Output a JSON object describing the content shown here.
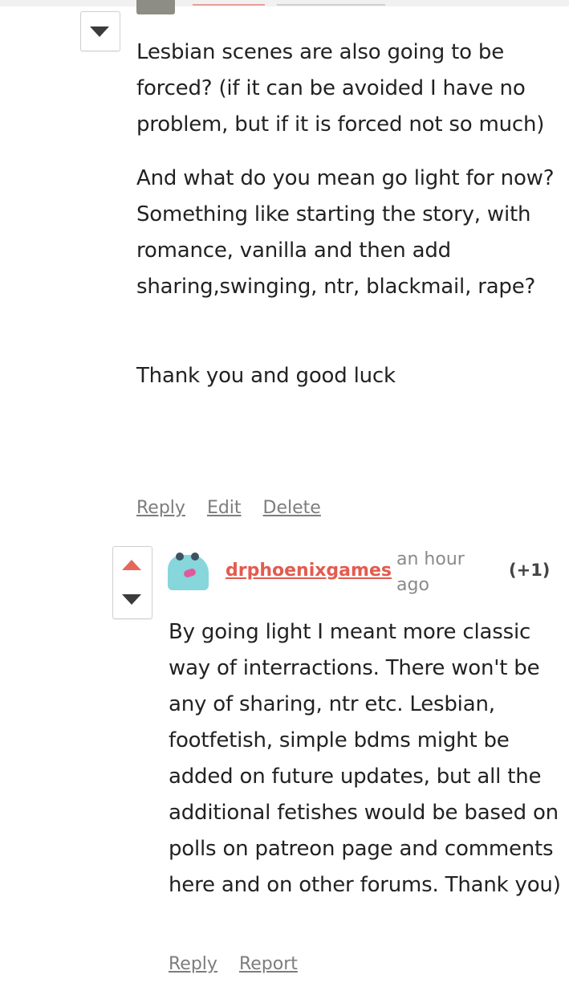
{
  "comment_parent": {
    "paragraphs": [
      "Lesbian scenes are also going to be forced? (if it can be avoided I have no problem, but if it is forced not so much)",
      "And what do you mean go light for now? Something like starting the story, with romance, vanilla and then add sharing,swinging, ntr, blackmail, rape?",
      "Thank you and good luck"
    ],
    "actions": {
      "reply": "Reply",
      "edit": "Edit",
      "delete": "Delete"
    }
  },
  "comment_reply": {
    "username": "drphoenixgames",
    "timestamp": "an hour ago",
    "score": "(+1)",
    "body": " By going light I meant more classic way of interractions. There won't be any of sharing, ntr etc.  Lesbian, footfetish, simple bdms  might be added on future updates, but all the additional fetishes would be based on polls on patreon page and comments here and on other forums. Thank you)",
    "actions": {
      "reply": "Reply",
      "report": "Report"
    }
  },
  "colors": {
    "accent": "#e35b4f",
    "avatar": "#86d6dc"
  }
}
